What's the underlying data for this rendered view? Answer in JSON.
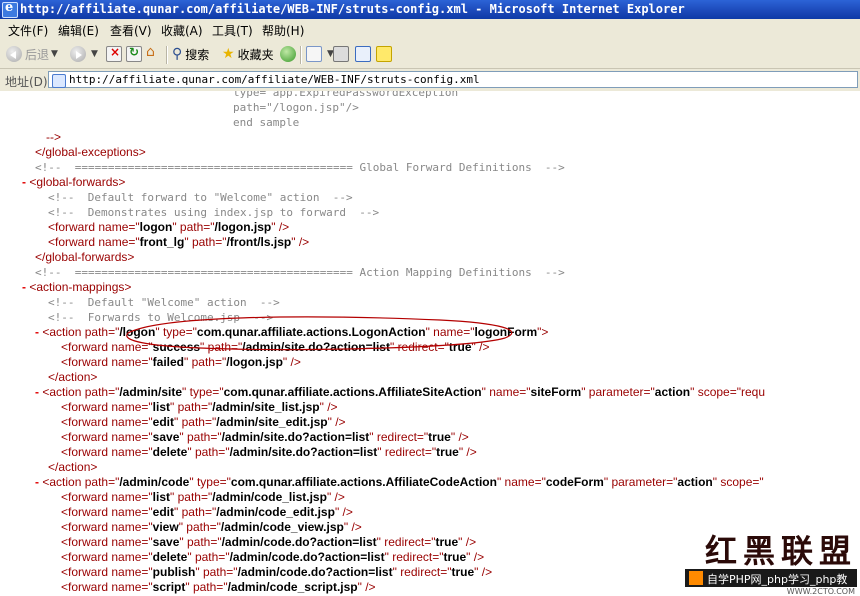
{
  "window": {
    "title": "http://affiliate.qunar.com/affiliate/WEB-INF/struts-config.xml - Microsoft Internet Explorer"
  },
  "menu": [
    "文件(F)",
    "编辑(E)",
    "查看(V)",
    "收藏(A)",
    "工具(T)",
    "帮助(H)"
  ],
  "toolbar": {
    "back": "后退",
    "search": "搜索",
    "favorites": "收藏夹"
  },
  "address": {
    "label": "地址(D)",
    "url": "http://affiliate.qunar.com/affiliate/WEB-INF/struts-config.xml"
  },
  "xml": {
    "l0": "type=\"app.ExpiredPasswordException\"",
    "l1": "path=\"/logon.jsp\"/>",
    "l2": "end sample",
    "l3": "-->",
    "l4": "</global-exceptions>",
    "l5": "<!--  ========================================== Global Forward Definitions  -->",
    "l6_toggle": "-",
    "l6": "<global-forwards>",
    "l7": "<!--  Default forward to \"Welcome\" action  -->",
    "l8": "<!--  Demonstrates using index.jsp to forward  -->",
    "l9a": "<forward",
    "l9b": "name=\"",
    "l9c": "logon",
    "l9d": "\" path=\"",
    "l9e": "/logon.jsp",
    "l9f": "\" />",
    "l10a": "<forward",
    "l10b": "name=\"",
    "l10c": "front_lg",
    "l10d": "\" path=\"",
    "l10e": "/front/ls.jsp",
    "l10f": "\" />",
    "l11": "</global-forwards>",
    "l12": "<!--  ========================================== Action Mapping Definitions  -->",
    "l13_toggle": "-",
    "l13": "<action-mappings>",
    "l14": "<!--  Default \"Welcome\" action  -->",
    "l15": "<!--  Forwards to Welcome.jsp  -->",
    "l16_toggle": "-",
    "l16a": "<action",
    "l16b": "path=\"",
    "l16c": "/logon",
    "l16d": "\" type=\"",
    "l16e": "com.qunar.affiliate.actions.LogonAction",
    "l16f": "\" name=\"",
    "l16g": "logonForm",
    "l16h": "\">",
    "l17a": "<forward",
    "l17b": "name=\"",
    "l17c": "success",
    "l17d": "\" path=\"",
    "l17e": "/admin/site.do?action=list",
    "l17f": "\" redirect=\"",
    "l17g": "true",
    "l17h": "\" />",
    "l18a": "<forward",
    "l18b": "name=\"",
    "l18c": "failed",
    "l18d": "\" path=\"",
    "l18e": "/logon.jsp",
    "l18f": "\" />",
    "l19": "</action>",
    "l20_toggle": "-",
    "l20a": "<action",
    "l20b": "path=\"",
    "l20c": "/admin/site",
    "l20d": "\" type=\"",
    "l20e": "com.qunar.affiliate.actions.AffiliateSiteAction",
    "l20f": "\" name=\"",
    "l20g": "siteForm",
    "l20h": "\" parameter=\"",
    "l20i": "action",
    "l20j": "\" scope=\"requ",
    "l21a": "<forward",
    "l21b": "name=\"",
    "l21c": "list",
    "l21d": "\" path=\"",
    "l21e": "/admin/site_list.jsp",
    "l21f": "\" />",
    "l22a": "<forward",
    "l22b": "name=\"",
    "l22c": "edit",
    "l22d": "\" path=\"",
    "l22e": "/admin/site_edit.jsp",
    "l22f": "\" />",
    "l23a": "<forward",
    "l23b": "name=\"",
    "l23c": "save",
    "l23d": "\" path=\"",
    "l23e": "/admin/site.do?action=list",
    "l23f": "\" redirect=\"",
    "l23g": "true",
    "l23h": "\" />",
    "l24a": "<forward",
    "l24b": "name=\"",
    "l24c": "delete",
    "l24d": "\" path=\"",
    "l24e": "/admin/site.do?action=list",
    "l24f": "\" redirect=\"",
    "l24g": "true",
    "l24h": "\" />",
    "l25": "</action>",
    "l26_toggle": "-",
    "l26a": "<action",
    "l26b": "path=\"",
    "l26c": "/admin/code",
    "l26d": "\" type=\"",
    "l26e": "com.qunar.affiliate.actions.AffiliateCodeAction",
    "l26f": "\" name=\"",
    "l26g": "codeForm",
    "l26h": "\" parameter=\"",
    "l26i": "action",
    "l26j": "\" scope=\"",
    "l27a": "<forward",
    "l27b": "name=\"",
    "l27c": "list",
    "l27d": "\" path=\"",
    "l27e": "/admin/code_list.jsp",
    "l27f": "\" />",
    "l28a": "<forward",
    "l28b": "name=\"",
    "l28c": "edit",
    "l28d": "\" path=\"",
    "l28e": "/admin/code_edit.jsp",
    "l28f": "\" />",
    "l29a": "<forward",
    "l29b": "name=\"",
    "l29c": "view",
    "l29d": "\" path=\"",
    "l29e": "/admin/code_view.jsp",
    "l29f": "\" />",
    "l30a": "<forward",
    "l30b": "name=\"",
    "l30c": "save",
    "l30d": "\" path=\"",
    "l30e": "/admin/code.do?action=list",
    "l30f": "\" redirect=\"",
    "l30g": "true",
    "l30h": "\" />",
    "l31a": "<forward",
    "l31b": "name=\"",
    "l31c": "delete",
    "l31d": "\" path=\"",
    "l31e": "/admin/code.do?action=list",
    "l31f": "\" redirect=\"",
    "l31g": "true",
    "l31h": "\" />",
    "l32a": "<forward",
    "l32b": "name=\"",
    "l32c": "publish",
    "l32d": "\" path=\"",
    "l32e": "/admin/code.do?action=list",
    "l32f": "\" redirect=\"",
    "l32g": "true",
    "l32h": "\" />",
    "l33a": "<forward",
    "l33b": "name=\"",
    "l33c": "script",
    "l33d": "\" path=\"",
    "l33e": "/admin/code_script.jsp",
    "l33f": "\" />"
  },
  "watermark": {
    "logo": "红黑联盟",
    "text": "自学PHP网_php学习_php教",
    "url": "WWW.2CTO.COM"
  },
  "colors": {
    "titlebar": "#1b48b8",
    "chrome": "#ece9d8",
    "tag": "#990000",
    "comment": "#888888",
    "toggle": "#e00000"
  }
}
